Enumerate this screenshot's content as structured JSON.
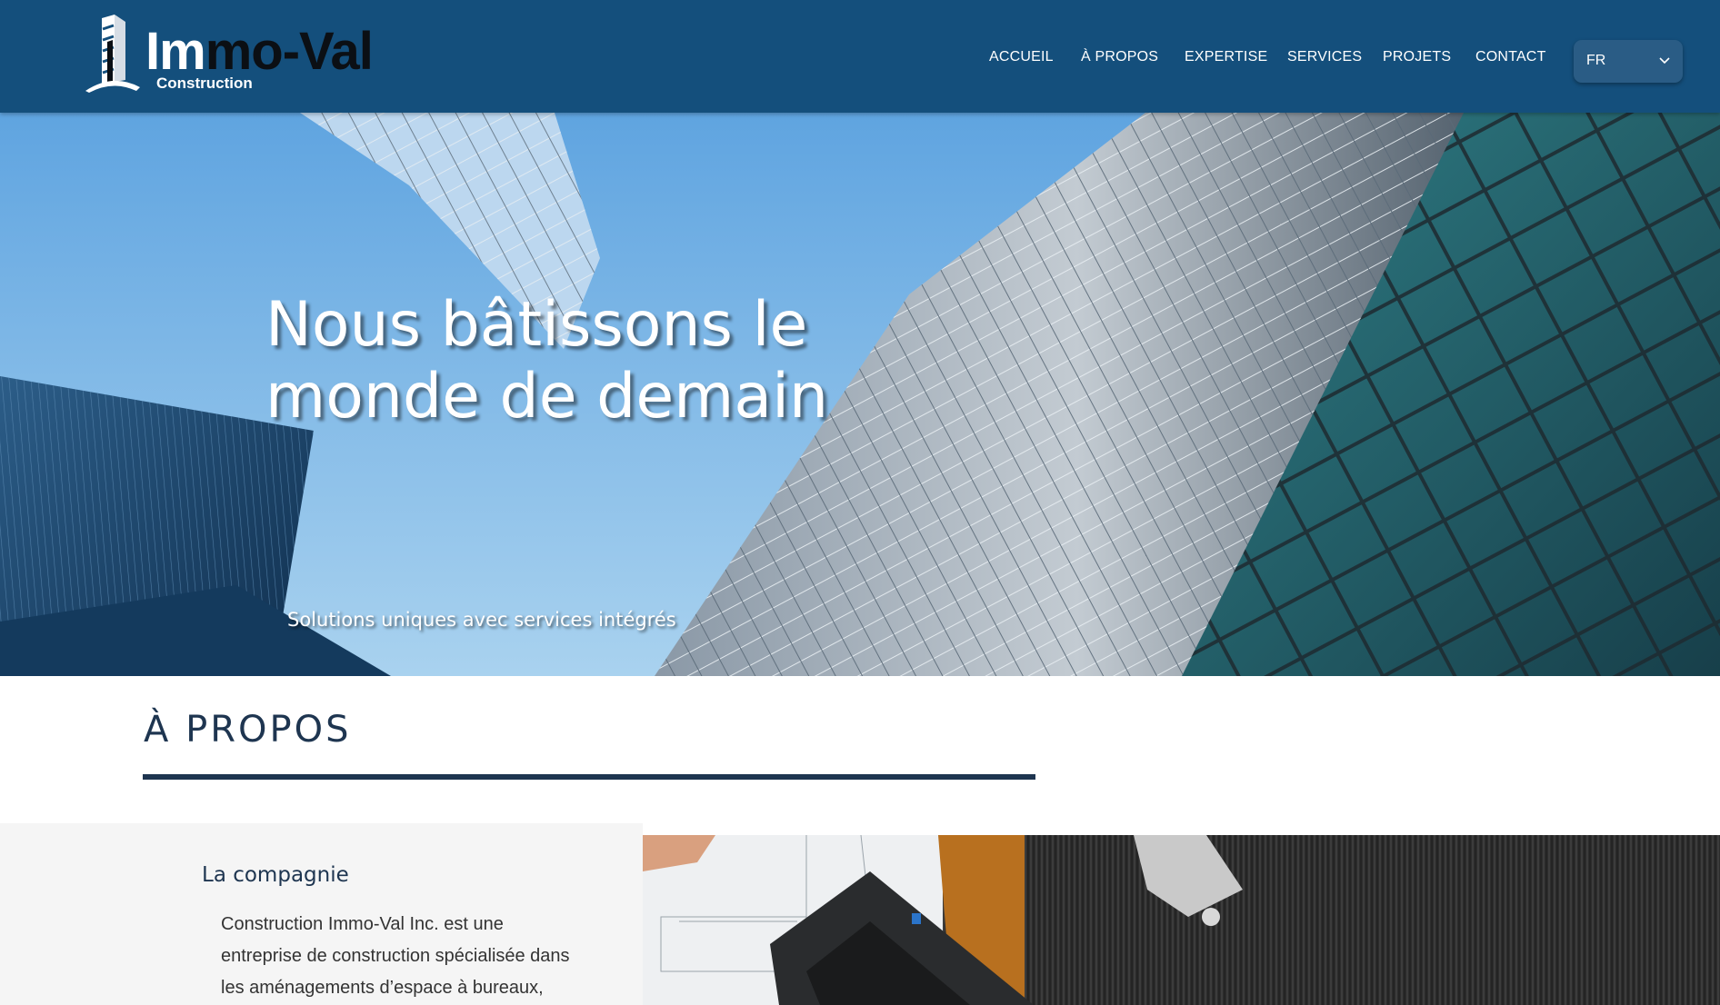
{
  "brand": {
    "name_first": "Im",
    "name_rest": "mo-Val",
    "subtitle": "Construction"
  },
  "nav": {
    "items": [
      "ACCUEIL",
      "À PROPOS",
      "EXPERTISE",
      "SERVICES",
      "PROJETS",
      "CONTACT"
    ]
  },
  "language": {
    "selected": "FR"
  },
  "hero": {
    "title_line1": "Nous bâtissons le",
    "title_line2": "monde de demain",
    "subtitle": "Solutions uniques avec services intégrés"
  },
  "about": {
    "title": "À PROPOS",
    "company_heading": "La compagnie",
    "company_lines": [
      "Construction Immo-Val Inc. est une",
      "entreprise de construction spécialisée dans",
      "les aménagements d’espace à bureaux,"
    ]
  },
  "colors": {
    "header_bg": "#144f7c",
    "accent_dark": "#1e3550",
    "panel_bg": "#f5f5f5"
  },
  "icons": [
    "building-logo-icon",
    "chevron-down-icon"
  ]
}
